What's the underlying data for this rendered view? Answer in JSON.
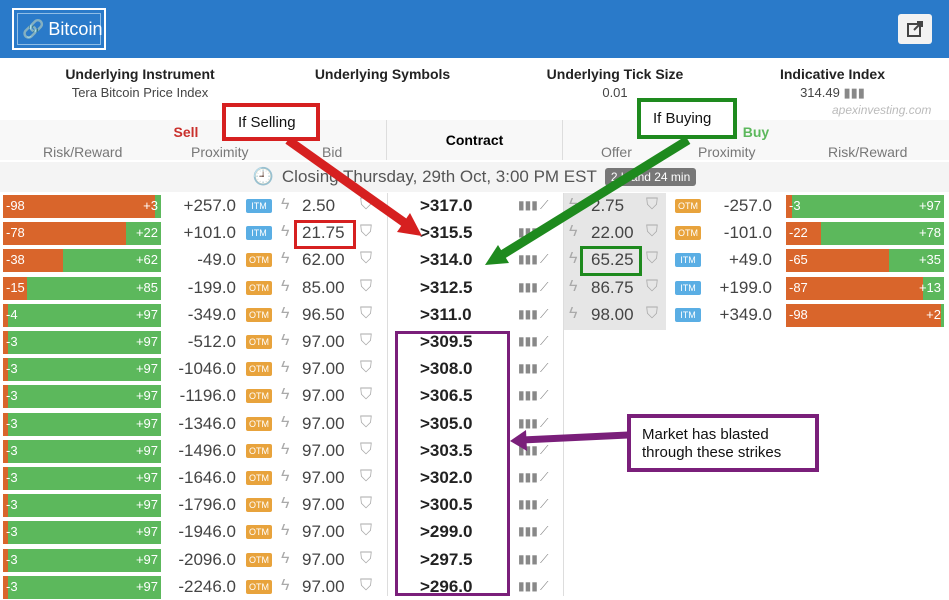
{
  "header": {
    "title": "Bitcoin",
    "colors": {
      "bar": "#2a7ac9"
    }
  },
  "info": {
    "underlying_instrument_label": "Underlying Instrument",
    "underlying_instrument_value": "Tera Bitcoin Price Index",
    "underlying_symbols_label": "Underlying Symbols",
    "tick_size_label": "Underlying Tick Size",
    "tick_size_value": "0.01",
    "indicative_index_label": "Indicative Index",
    "indicative_index_value": "314.49",
    "watermark": "apexinvesting.com"
  },
  "columns": {
    "sell": "Sell",
    "buy": "Buy",
    "risk_reward_left": "Risk/Reward",
    "proximity_left": "Proximity",
    "bid": "Bid",
    "contract": "Contract",
    "offer": "Offer",
    "proximity_right": "Proximity",
    "risk_reward_right": "Risk/Reward"
  },
  "closing": {
    "text": "Closing Thursday, 29th Oct, 3:00 PM EST",
    "badge": "2 h and 24 min"
  },
  "colors": {
    "red": "#d9652b",
    "green": "#5cb85c",
    "itm": "#5aaee4",
    "otm": "#e8a33c"
  },
  "rows": [
    {
      "rl_left": "-98",
      "rl_right": "+3",
      "rl_green": 0.04,
      "prox": "+257.0",
      "tag": "ITM",
      "bid": "2.50",
      "contract": ">317.0",
      "offer": "2.75",
      "otag": "OTM",
      "oprox": "-257.0",
      "rr_left": "-3",
      "rr_right": "+97",
      "rr_red": 0.04
    },
    {
      "rl_left": "-78",
      "rl_right": "+22",
      "rl_green": 0.22,
      "prox": "+101.0",
      "tag": "ITM",
      "bid": "21.75",
      "contract": ">315.5",
      "offer": "22.00",
      "otag": "OTM",
      "oprox": "-101.0",
      "rr_left": "-22",
      "rr_right": "+78",
      "rr_red": 0.22
    },
    {
      "rl_left": "-38",
      "rl_right": "+62",
      "rl_green": 0.62,
      "prox": "-49.0",
      "tag": "OTM",
      "bid": "62.00",
      "contract": ">314.0",
      "offer": "65.25",
      "otag": "ITM",
      "oprox": "+49.0",
      "rr_left": "-65",
      "rr_right": "+35",
      "rr_red": 0.65
    },
    {
      "rl_left": "-15",
      "rl_right": "+85",
      "rl_green": 0.85,
      "prox": "-199.0",
      "tag": "OTM",
      "bid": "85.00",
      "contract": ">312.5",
      "offer": "86.75",
      "otag": "ITM",
      "oprox": "+199.0",
      "rr_left": "-87",
      "rr_right": "+13",
      "rr_red": 0.87
    },
    {
      "rl_left": "-4",
      "rl_right": "+97",
      "rl_green": 0.97,
      "prox": "-349.0",
      "tag": "OTM",
      "bid": "96.50",
      "contract": ">311.0",
      "offer": "98.00",
      "otag": "ITM",
      "oprox": "+349.0",
      "rr_left": "-98",
      "rr_right": "+2",
      "rr_red": 0.98
    },
    {
      "rl_left": "-3",
      "rl_right": "+97",
      "rl_green": 0.97,
      "prox": "-512.0",
      "tag": "OTM",
      "bid": "97.00",
      "contract": ">309.5"
    },
    {
      "rl_left": "-3",
      "rl_right": "+97",
      "rl_green": 0.97,
      "prox": "-1046.0",
      "tag": "OTM",
      "bid": "97.00",
      "contract": ">308.0"
    },
    {
      "rl_left": "-3",
      "rl_right": "+97",
      "rl_green": 0.97,
      "prox": "-1196.0",
      "tag": "OTM",
      "bid": "97.00",
      "contract": ">306.5"
    },
    {
      "rl_left": "-3",
      "rl_right": "+97",
      "rl_green": 0.97,
      "prox": "-1346.0",
      "tag": "OTM",
      "bid": "97.00",
      "contract": ">305.0"
    },
    {
      "rl_left": "-3",
      "rl_right": "+97",
      "rl_green": 0.97,
      "prox": "-1496.0",
      "tag": "OTM",
      "bid": "97.00",
      "contract": ">303.5"
    },
    {
      "rl_left": "-3",
      "rl_right": "+97",
      "rl_green": 0.97,
      "prox": "-1646.0",
      "tag": "OTM",
      "bid": "97.00",
      "contract": ">302.0"
    },
    {
      "rl_left": "-3",
      "rl_right": "+97",
      "rl_green": 0.97,
      "prox": "-1796.0",
      "tag": "OTM",
      "bid": "97.00",
      "contract": ">300.5"
    },
    {
      "rl_left": "-3",
      "rl_right": "+97",
      "rl_green": 0.97,
      "prox": "-1946.0",
      "tag": "OTM",
      "bid": "97.00",
      "contract": ">299.0"
    },
    {
      "rl_left": "-3",
      "rl_right": "+97",
      "rl_green": 0.97,
      "prox": "-2096.0",
      "tag": "OTM",
      "bid": "97.00",
      "contract": ">297.5"
    },
    {
      "rl_left": "-3",
      "rl_right": "+97",
      "rl_green": 0.97,
      "prox": "-2246.0",
      "tag": "OTM",
      "bid": "97.00",
      "contract": ">296.0"
    }
  ],
  "annotations": {
    "selling": "If Selling",
    "buying": "If Buying",
    "blasted": "Market has blasted through these strikes"
  }
}
